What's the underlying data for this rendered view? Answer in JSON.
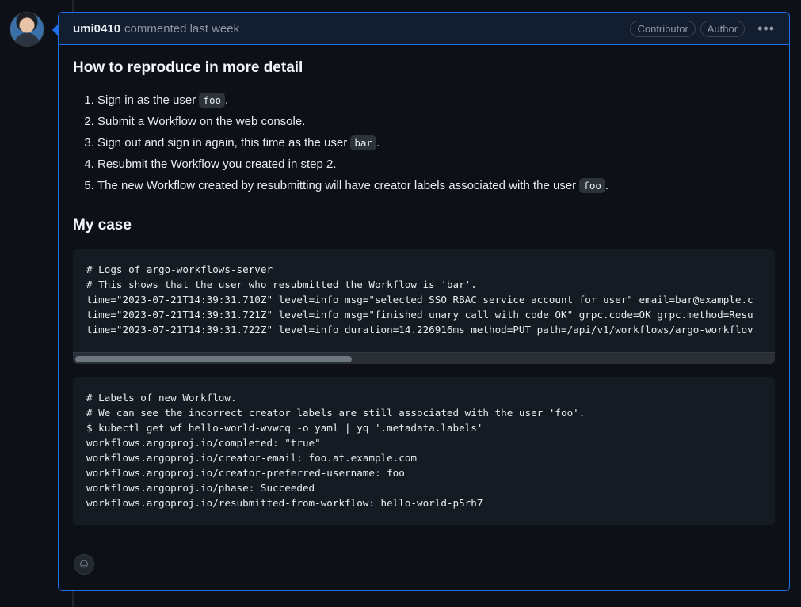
{
  "comment": {
    "author": "umi0410",
    "meta": "commented last week",
    "badges": [
      "Contributor",
      "Author"
    ],
    "menu_icon": "kebab-horizontal-icon"
  },
  "body": {
    "heading1": "How to reproduce in more detail",
    "steps": [
      {
        "pre": "Sign in as the user ",
        "code": "foo",
        "post": "."
      },
      {
        "pre": "Submit a Workflow on the web console.",
        "code": "",
        "post": ""
      },
      {
        "pre": "Sign out and sign in again, this time as the user ",
        "code": "bar",
        "post": "."
      },
      {
        "pre": "Resubmit the Workflow you created in step 2.",
        "code": "",
        "post": ""
      },
      {
        "pre": "The new Workflow created by resubmitting will have creator labels associated with the user ",
        "code": "foo",
        "post": "."
      }
    ],
    "heading2": "My case",
    "code_block_1": [
      "# Logs of argo-workflows-server",
      "# This shows that the user who resubmitted the Workflow is 'bar'.",
      "time=\"2023-07-21T14:39:31.710Z\" level=info msg=\"selected SSO RBAC service account for user\" email=bar@example.c",
      "time=\"2023-07-21T14:39:31.721Z\" level=info msg=\"finished unary call with code OK\" grpc.code=OK grpc.method=Resu",
      "time=\"2023-07-21T14:39:31.722Z\" level=info duration=14.226916ms method=PUT path=/api/v1/workflows/argo-workflov"
    ],
    "code_block_2": [
      "# Labels of new Workflow.",
      "# We can see the incorrect creator labels are still associated with the user 'foo'.",
      "$ kubectl get wf hello-world-wvwcq -o yaml | yq '.metadata.labels'",
      "workflows.argoproj.io/completed: \"true\"",
      "workflows.argoproj.io/creator-email: foo.at.example.com",
      "workflows.argoproj.io/creator-preferred-username: foo",
      "workflows.argoproj.io/phase: Succeeded",
      "workflows.argoproj.io/resubmitted-from-workflow: hello-world-p5rh7"
    ],
    "reaction_icon": "smiley-icon",
    "code_block_1_scroll_fraction": 0.39
  }
}
